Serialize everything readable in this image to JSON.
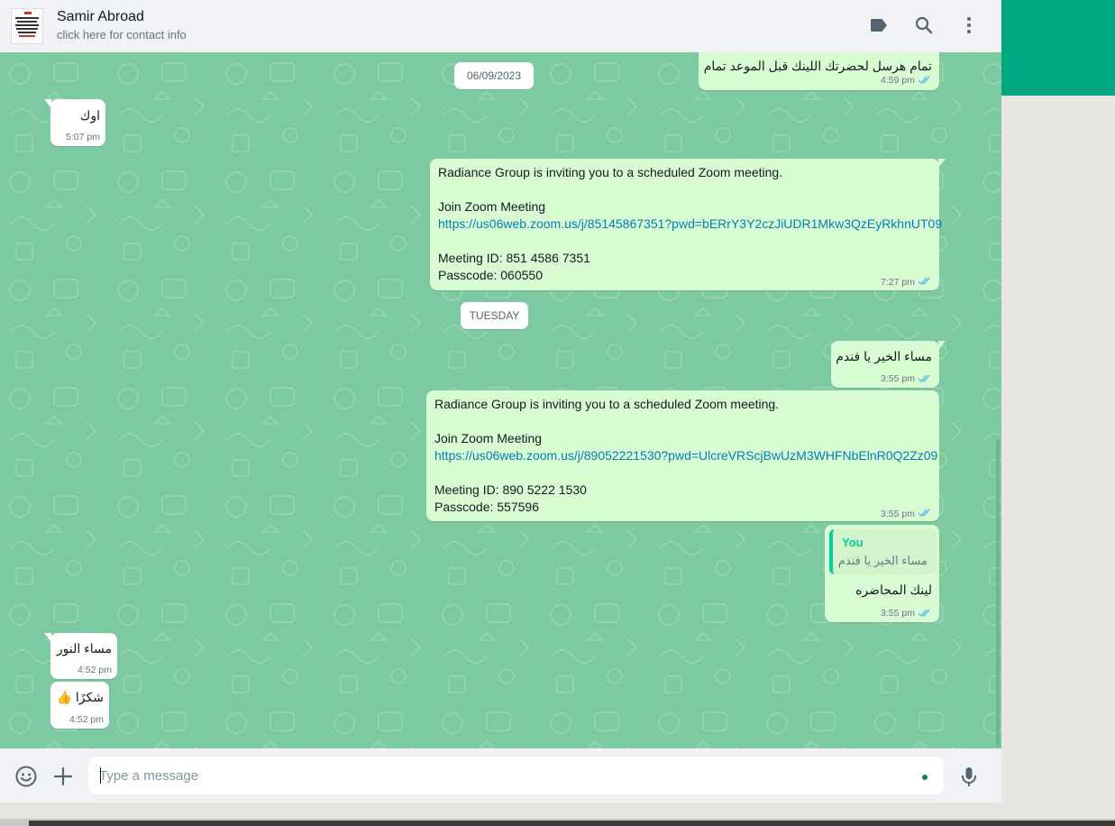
{
  "header": {
    "name": "Samir Abroad",
    "subtitle": "click here for contact info",
    "icons": [
      "label-icon",
      "search-icon",
      "menu-icon"
    ]
  },
  "messages": {
    "m1": {
      "text": "تمام هرسل لحضرتك اللينك قبل الموعد تمام",
      "time": "4:59 pm",
      "direction": "outgoing"
    },
    "date1": "06/09/2023",
    "m2": {
      "text": "اوك",
      "time": "5:07 pm",
      "direction": "incoming"
    },
    "m3": {
      "line1": "Radiance Group is inviting you to a scheduled Zoom meeting.",
      "line2": "Join Zoom Meeting",
      "link": "https://us06web.zoom.us/j/85145867351?pwd=bERrY3Y2czJiUDR1Mkw3QzEyRkhnUT09",
      "line3": "Meeting ID: 851 4586 7351",
      "line4": "Passcode: 060550",
      "time": "7:27 pm",
      "direction": "outgoing"
    },
    "date2": "TUESDAY",
    "m4": {
      "text": "مساء الخير يا فندم",
      "time": "3:55 pm",
      "direction": "outgoing"
    },
    "m5": {
      "line1": "Radiance Group is inviting you to a scheduled Zoom meeting.",
      "line2": "Join Zoom Meeting",
      "link": "https://us06web.zoom.us/j/89052221530?pwd=UlcreVRScjBwUzM3WHFNbElnR0Q2Zz09",
      "line3": "Meeting ID: 890 5222 1530",
      "line4": "Passcode: 557596",
      "time": "3:55 pm",
      "direction": "outgoing"
    },
    "m6": {
      "quote_name": "You",
      "quote_text": "مساء الخير يا فندم",
      "text": "لينك المحاضره",
      "time": "3:55 pm",
      "direction": "outgoing"
    },
    "m7": {
      "text": "مساء النور",
      "time": "4:52 pm",
      "direction": "incoming"
    },
    "m8": {
      "text": "شكرًا 👍",
      "time": "4:52 pm",
      "direction": "incoming"
    }
  },
  "composer": {
    "placeholder": "Type a message",
    "icons": [
      "emoji-icon",
      "attach-plus-icon",
      "microphone-icon"
    ]
  },
  "colors": {
    "accent": "#00a884",
    "chat_bg": "#7dc9a1",
    "outgoing_bubble": "#d9fdd3",
    "incoming_bubble": "#ffffff",
    "link": "#027eb5",
    "read_ticks": "#53bdeb"
  }
}
